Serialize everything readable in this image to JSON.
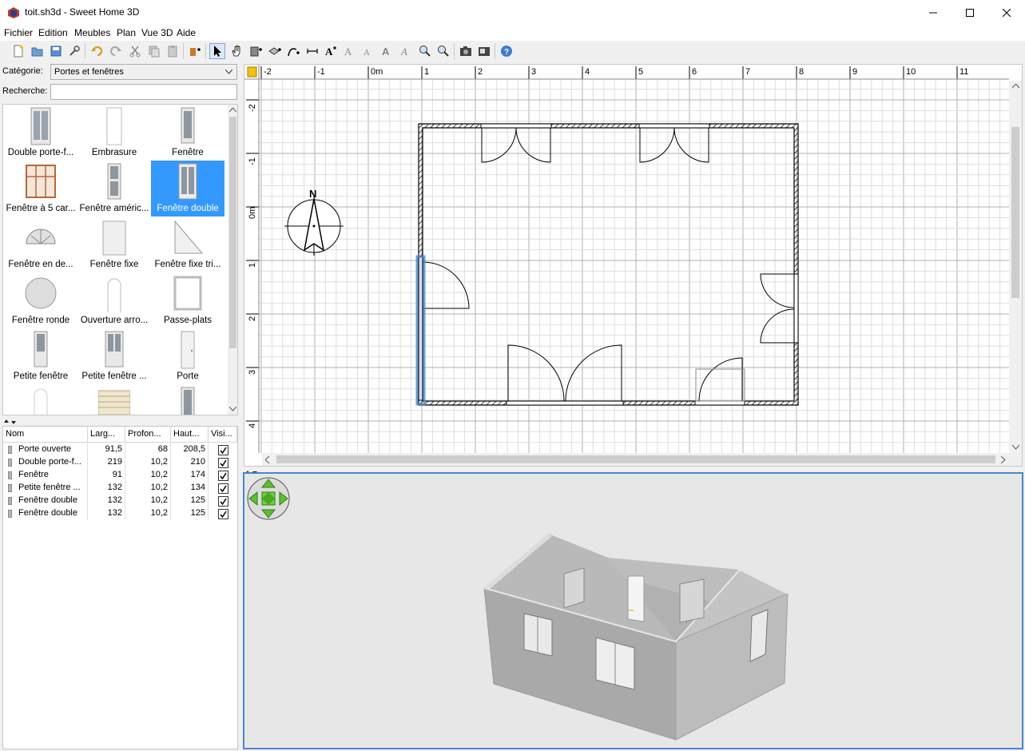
{
  "window": {
    "title": "toit.sh3d - Sweet Home 3D"
  },
  "menu": [
    "Fichier",
    "Edition",
    "Meubles",
    "Plan",
    "Vue 3D",
    "Aide"
  ],
  "toolbar_icons": [
    "new-file-icon",
    "open-file-icon",
    "save-icon",
    "preferences-icon",
    "undo-icon",
    "redo-icon",
    "cut-icon",
    "copy-icon",
    "paste-icon",
    "add-furniture-icon",
    "select-icon",
    "pan-icon",
    "create-walls-icon",
    "create-rooms-icon",
    "create-polylines-icon",
    "create-dimensions-icon",
    "add-text-icon",
    "increase-text-size-icon",
    "decrease-text-size-icon",
    "bold-text-icon",
    "italic-text-icon",
    "zoom-in-icon",
    "zoom-out-icon",
    "photo-icon",
    "video-icon",
    "help-icon"
  ],
  "catalog": {
    "category_label": "Catégorie:",
    "category_value": "Portes et fenêtres",
    "search_label": "Recherche:",
    "search_value": "",
    "items": [
      {
        "label": "Double porte-f...",
        "selected": false
      },
      {
        "label": "Embrasure",
        "selected": false
      },
      {
        "label": "Fenêtre",
        "selected": false
      },
      {
        "label": "Fenêtre à 5 car...",
        "selected": false
      },
      {
        "label": "Fenêtre améric...",
        "selected": false
      },
      {
        "label": "Fenêtre double",
        "selected": true
      },
      {
        "label": "Fenêtre en de...",
        "selected": false
      },
      {
        "label": "Fenêtre fixe",
        "selected": false
      },
      {
        "label": "Fenêtre fixe tri...",
        "selected": false
      },
      {
        "label": "Fenêtre ronde",
        "selected": false
      },
      {
        "label": "Ouverture arro...",
        "selected": false
      },
      {
        "label": "Passe-plats",
        "selected": false
      },
      {
        "label": "Petite fenêtre",
        "selected": false
      },
      {
        "label": "Petite fenêtre ...",
        "selected": false
      },
      {
        "label": "Porte",
        "selected": false
      }
    ]
  },
  "furniture": {
    "columns": [
      "Nom",
      "Larg...",
      "Profon...",
      "Haut...",
      "Visi..."
    ],
    "rows": [
      {
        "name": "Porte ouverte",
        "width": "91,5",
        "depth": "68",
        "height": "208,5",
        "visible": true
      },
      {
        "name": "Double porte-f...",
        "width": "219",
        "depth": "10,2",
        "height": "210",
        "visible": true
      },
      {
        "name": "Fenêtre",
        "width": "91",
        "depth": "10,2",
        "height": "174",
        "visible": true
      },
      {
        "name": "Petite fenêtre ...",
        "width": "132",
        "depth": "10,2",
        "height": "134",
        "visible": true
      },
      {
        "name": "Fenêtre double",
        "width": "132",
        "depth": "10,2",
        "height": "125",
        "visible": true
      },
      {
        "name": "Fenêtre double",
        "width": "132",
        "depth": "10,2",
        "height": "125",
        "visible": true
      }
    ]
  },
  "plan": {
    "ruler_x": [
      "-2",
      "-1",
      "0m",
      "1",
      "2",
      "3",
      "4",
      "5",
      "6",
      "7",
      "8",
      "9",
      "10",
      "11"
    ],
    "ruler_y": [
      "-2",
      "-1",
      "0m",
      "1",
      "2",
      "3",
      "4"
    ],
    "compass_label": "N"
  },
  "colors": {
    "accent": "#3399ff",
    "selection": "#4a86c8",
    "wall": "#000000",
    "grid": "#d9d9d9",
    "view3d_bg": "#e7e7e7",
    "nav_green": "#5cbf2a"
  }
}
